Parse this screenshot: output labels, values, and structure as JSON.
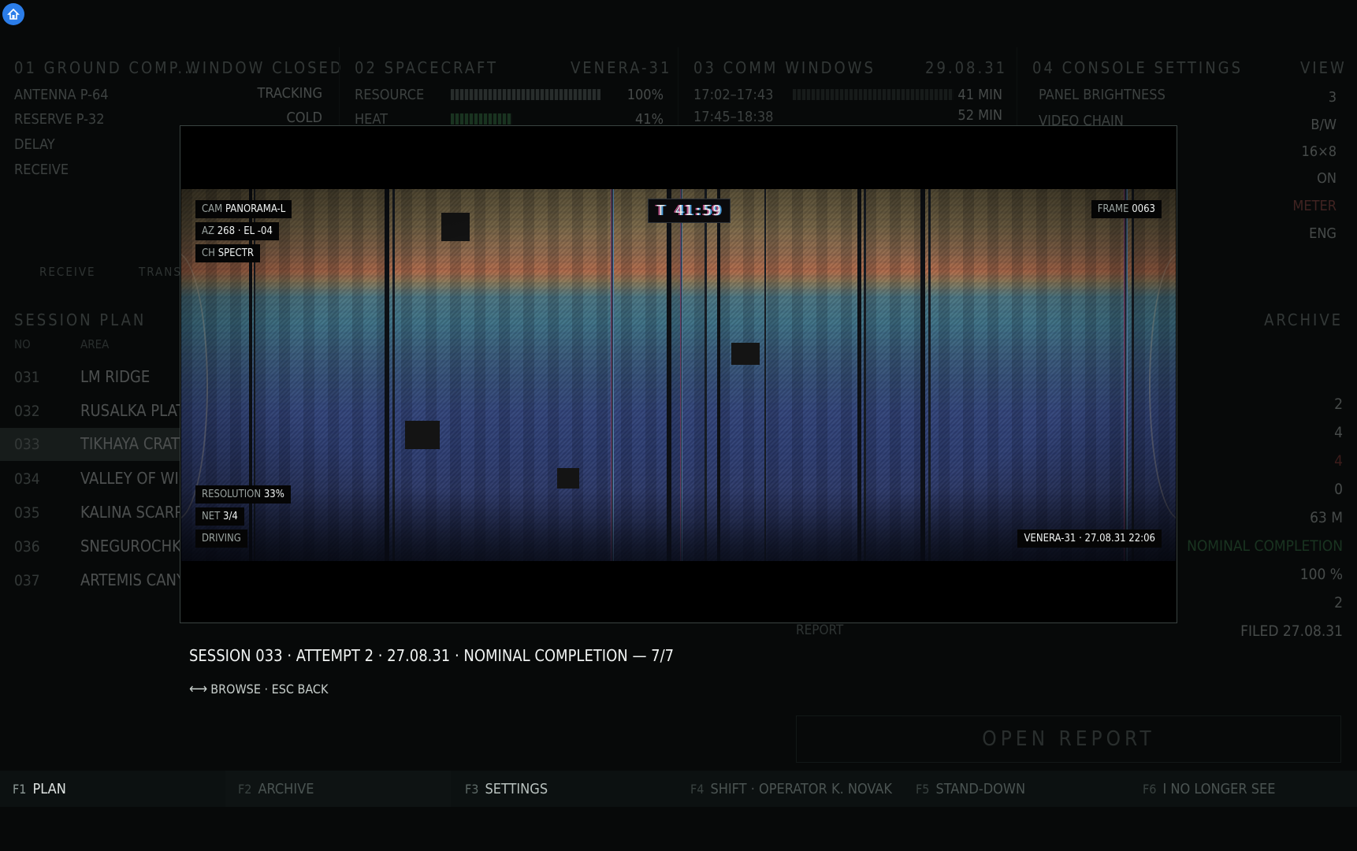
{
  "panels": {
    "ground": {
      "title": "01 GROUND COMP...",
      "status": "WINDOW CLOSED",
      "rows": [
        {
          "label": "ANTENNA P-64",
          "value": "TRACKING"
        },
        {
          "label": "RESERVE P-32",
          "value": "COLD"
        },
        {
          "label": "DELAY",
          "value": ""
        },
        {
          "label": "RECEIVE",
          "value": ""
        }
      ]
    },
    "spacecraft": {
      "title": "02 SPACECRAFT",
      "name": "VENERA-31",
      "rows": [
        {
          "label": "RESOURCE",
          "value": "100%",
          "level": 1.0
        },
        {
          "label": "HEAT",
          "value": "41%",
          "level": 0.41
        }
      ]
    },
    "comm": {
      "title": "03 COMM WINDOWS",
      "date": "29.08.31",
      "rows": [
        {
          "label": "17:02–17:43",
          "value": "41 MIN"
        },
        {
          "label": "17:45–18:38",
          "value": "52 MIN"
        }
      ]
    },
    "settings": {
      "title": "04 CONSOLE SETTINGS",
      "action": "VIEW",
      "rows": [
        {
          "label": "PANEL BRIGHTNESS",
          "value": "3"
        },
        {
          "label": "VIDEO CHAIN",
          "value": "B/W"
        },
        {
          "label": "",
          "value": "16×8"
        },
        {
          "label": "",
          "value": "ON"
        },
        {
          "label": "",
          "value": "METER"
        },
        {
          "label": "",
          "value": "ENG"
        }
      ]
    }
  },
  "tabs": {
    "receive": "RECEIVE",
    "transmit": "TRANS"
  },
  "session_plan": {
    "title": "SESSION PLAN",
    "col_no": "NO",
    "col_area": "AREA",
    "rows": [
      {
        "no": "031",
        "area": "LM RIDGE"
      },
      {
        "no": "032",
        "area": "RUSALKA PLATEA"
      },
      {
        "no": "033",
        "area": "TIKHAYA CRATER"
      },
      {
        "no": "034",
        "area": "VALLEY OF WIND"
      },
      {
        "no": "035",
        "area": "KALINA SCARP"
      },
      {
        "no": "036",
        "area": "SNEGUROCHKA F"
      },
      {
        "no": "037",
        "area": "ARTEMIS CANYO"
      }
    ]
  },
  "archive": {
    "title": "ARCHIVE",
    "values": [
      "2",
      "4",
      "4",
      "0",
      "63 M",
      "NOMINAL COMPLETION",
      "100 %",
      "2"
    ],
    "report_label": "REPORT",
    "report_value": "FILED 27.08.31",
    "open_report": "OPEN REPORT"
  },
  "footer": [
    {
      "key": "F1",
      "label": "PLAN"
    },
    {
      "key": "F2",
      "label": "ARCHIVE"
    },
    {
      "key": "F3",
      "label": "SETTINGS"
    },
    {
      "key": "F4",
      "label": "SHIFT · OPERATOR K. NOVAK"
    },
    {
      "key": "F5",
      "label": "STAND-DOWN"
    },
    {
      "key": "F6",
      "label": "I NO LONGER SEE"
    }
  ],
  "viewer": {
    "cam_label": "CAM",
    "cam_value": "PANORAMA-L",
    "az_label": "AZ",
    "az_value": "268 · EL -04",
    "ch_label": "CH",
    "ch_value": "SPECTR",
    "timer": "T 41:59",
    "frame_label": "FRAME",
    "frame_value": "0063",
    "res_label": "RESOLUTION",
    "res_value": "33%",
    "net_label": "NET",
    "net_value": "3/4",
    "mode": "DRIVING",
    "stamp": "VENERA-31 · 27.08.31 22:06",
    "caption": "SESSION 033 · ATTEMPT 2 · 27.08.31 · NOMINAL COMPLETION — 7/7",
    "hint_arrow": "⟷",
    "hint": "BROWSE · ESC BACK"
  },
  "colors": {
    "accent_green": "#3f8a4f",
    "warning_red": "#a6453f",
    "app_icon": "#2b7de9"
  }
}
